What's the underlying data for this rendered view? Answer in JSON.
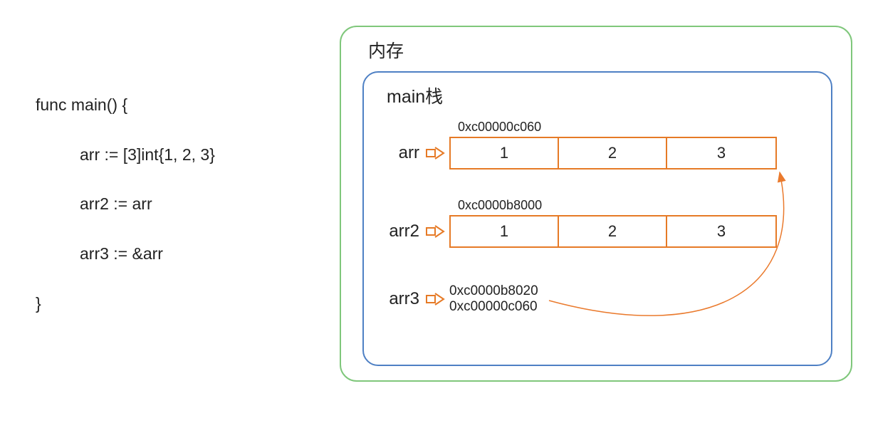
{
  "code": {
    "l1": "func main() {",
    "l2": "arr := [3]int{1, 2, 3}",
    "l3": "arr2 := arr",
    "l4": "arr3 := &arr",
    "l5": "}"
  },
  "memory": {
    "outer_title": "内存",
    "inner_title": "main栈",
    "arr": {
      "label": "arr",
      "addr": "0xc00000c060",
      "cells": {
        "c0": "1",
        "c1": "2",
        "c2": "3"
      }
    },
    "arr2": {
      "label": "arr2",
      "addr": "0xc0000b8000",
      "cells": {
        "c0": "1",
        "c1": "2",
        "c2": "3"
      }
    },
    "arr3": {
      "label": "arr3",
      "addr": "0xc0000b8020",
      "value": "0xc00000c060"
    }
  }
}
